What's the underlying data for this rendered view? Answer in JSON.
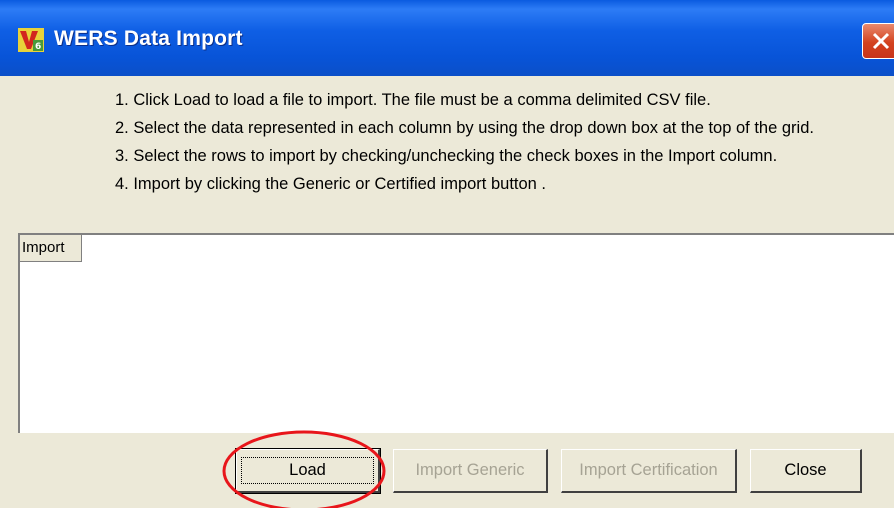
{
  "window": {
    "title": "WERS Data Import",
    "icon": "app-logo-icon",
    "close_icon": "close-icon"
  },
  "instructions": [
    "1. Click Load to load a file to import. The file must be a comma delimited CSV file.",
    "2. Select the data represented in each column by using the drop down box at the top of the grid.",
    "3. Select the rows to import by checking/unchecking the check boxes in the Import column.",
    "4. Import by clicking the Generic or Certified import button ."
  ],
  "grid": {
    "columns": [
      "Import"
    ]
  },
  "buttons": {
    "load": "Load",
    "import_generic": "Import Generic",
    "import_certification": "Import Certification",
    "close": "Close"
  },
  "colors": {
    "titlebar": "#0854d8",
    "window_bg": "#ece9d8",
    "highlight": "#e8161b"
  }
}
